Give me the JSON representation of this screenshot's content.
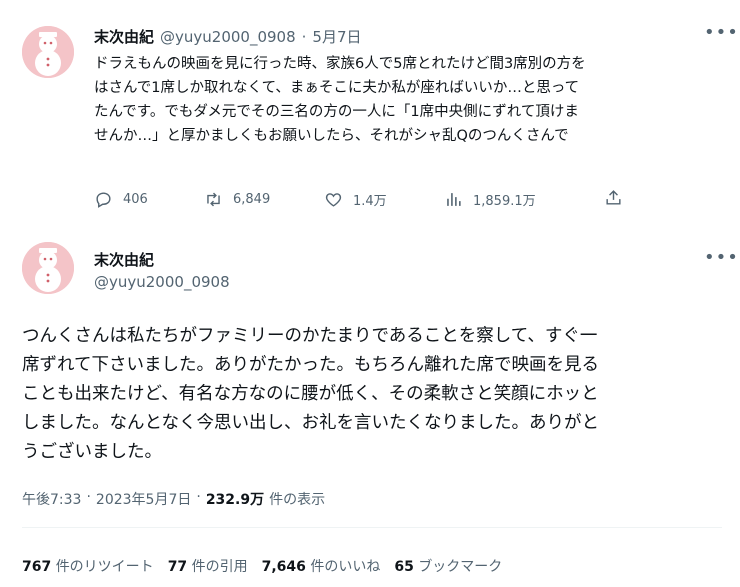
{
  "tweet1": {
    "display_name": "末次由紀",
    "handle": "@yuyu2000_0908",
    "separator": "·",
    "date": "5月7日",
    "lines": [
      "ドラえもんの映画を見に行った時、家族6人で5席とれたけど間3席別の方を",
      "はさんで1席しか取れなくて、まぁそこに夫か私が座ればいいか…と思って",
      "たんです。でもダメ元でその三名の方の一人に「1席中央側にずれて頂けま",
      "せんか…」と厚かましくもお願いしたら、それがシャ乱Qのつんくさんで"
    ],
    "actions": {
      "reply_count": "406",
      "retweet_count": "6,849",
      "like_count": "1.4万",
      "views_count": "1,859.1万"
    }
  },
  "tweet2": {
    "display_name": "末次由紀",
    "handle": "@yuyu2000_0908",
    "lines": [
      "つんくさんは私たちがファミリーのかたまりであることを察して、すぐ一",
      "席ずれて下さいました。ありがたかった。もちろん離れた席で映画を見る",
      "ことも出来たけど、有名な方なのに腰が低く、その柔軟さと笑顔にホッと",
      "しました。なんとなく今思い出し、お礼を言いたくなりました。ありがと",
      "うございました。"
    ],
    "meta": {
      "time": "午後7:33",
      "separator": "·",
      "date": "2023年5月7日",
      "separator2": "·",
      "views": "232.9万",
      "views_label": "件の表示"
    },
    "stats": {
      "retweets": "767",
      "retweets_label": "件のリツイート",
      "quotes": "77",
      "quotes_label": "件の引用",
      "likes": "7,646",
      "likes_label": "件のいいね",
      "bookmarks": "65",
      "bookmarks_label": "ブックマーク"
    }
  },
  "colors": {
    "text": "#0f1419",
    "muted": "#536471",
    "avatar_bg": "#f4c4c8",
    "divider": "#eff3f4"
  },
  "icons": [
    "more-icon",
    "reply-icon",
    "retweet-icon",
    "like-icon",
    "views-icon",
    "share-icon"
  ]
}
